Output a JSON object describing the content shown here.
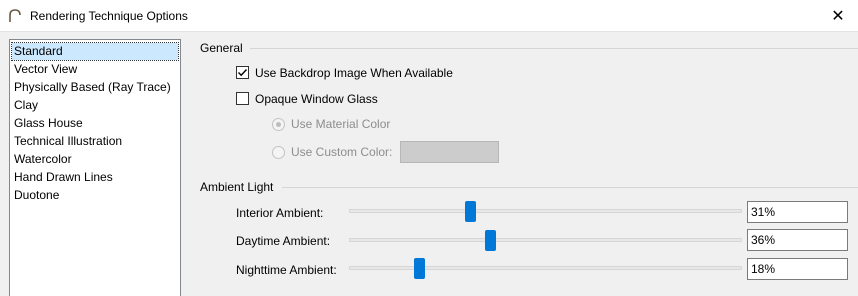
{
  "window": {
    "title": "Rendering Technique Options",
    "icon": "arch-icon",
    "close_glyph": "✕"
  },
  "techniques": {
    "selected_index": 0,
    "items": [
      "Standard",
      "Vector View",
      "Physically Based (Ray Trace)",
      "Clay",
      "Glass House",
      "Technical Illustration",
      "Watercolor",
      "Hand Drawn Lines",
      "Duotone"
    ]
  },
  "general": {
    "heading": "General",
    "use_backdrop": {
      "label": "Use Backdrop Image When Available",
      "checked": true
    },
    "opaque_glass": {
      "label": "Opaque Window Glass",
      "checked": false
    },
    "use_material_color": {
      "label": "Use Material Color",
      "selected": true,
      "enabled": false
    },
    "use_custom_color": {
      "label": "Use Custom Color:",
      "selected": false,
      "enabled": false
    },
    "custom_color": "#cccccc"
  },
  "ambient": {
    "heading": "Ambient Light",
    "interior": {
      "label": "Interior Ambient:",
      "value": "31%",
      "level": 31
    },
    "daytime": {
      "label": "Daytime Ambient:",
      "value": "36%",
      "level": 36
    },
    "nighttime": {
      "label": "Nighttime Ambient:",
      "value": "18%",
      "level": 18
    }
  },
  "colors": {
    "accent": "#0078d7",
    "selection": "#cce8ff",
    "disabled_text": "#8d8d8d"
  }
}
